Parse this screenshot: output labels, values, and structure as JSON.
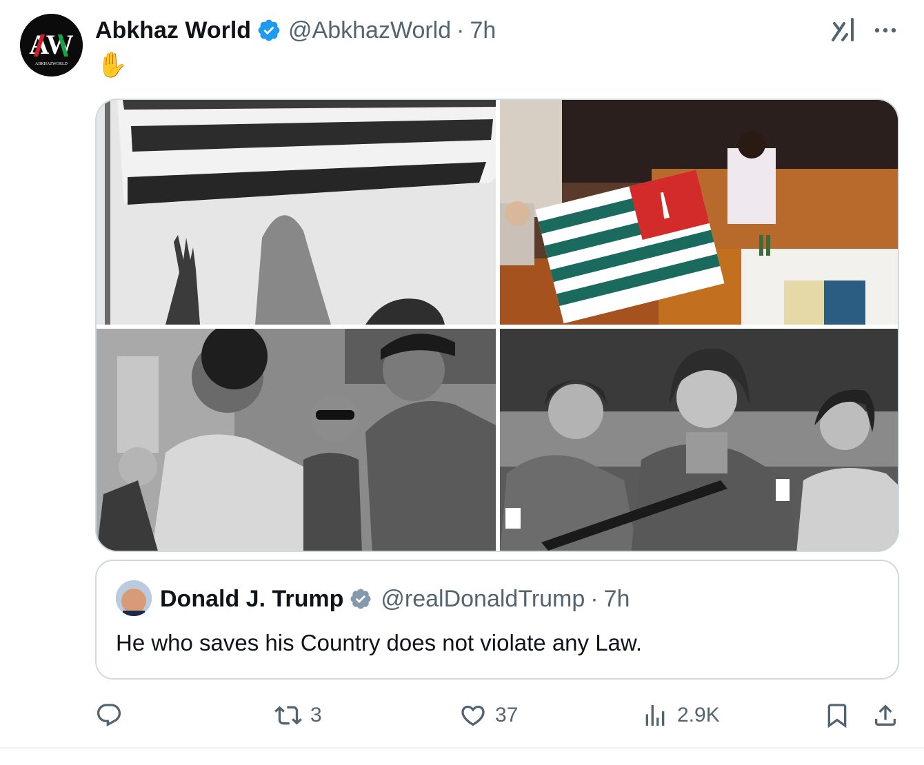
{
  "post": {
    "author_name": "Abkhaz World",
    "author_handle": "@AbkhazWorld",
    "separator": "·",
    "time": "7h",
    "avatar_text": "AW",
    "avatar_subtext": "ABKHAZWORLD",
    "text": "✋"
  },
  "media": {
    "images": [
      {
        "description": "black-and-white-flag-raising-crowd"
      },
      {
        "description": "color-abkhaz-flag-presented-on-stage"
      },
      {
        "description": "black-and-white-men-greeting"
      },
      {
        "description": "black-and-white-three-women-soldiers"
      }
    ]
  },
  "quoted": {
    "author_name": "Donald J. Trump",
    "author_handle": "@realDonaldTrump",
    "separator": "·",
    "time": "7h",
    "text": "He who saves his Country does not violate any Law."
  },
  "actions": {
    "reply_count": "",
    "repost_count": "3",
    "like_count": "37",
    "views_count": "2.9K"
  },
  "colors": {
    "text_primary": "#0f1419",
    "text_secondary": "#536471",
    "verified_blue": "#1d9bf0",
    "verified_gray": "#829aab",
    "border": "#cfd9de"
  },
  "icons": [
    "verified-badge-icon",
    "grok-icon",
    "more-icon",
    "reply-icon",
    "repost-icon",
    "like-icon",
    "views-icon",
    "bookmark-icon",
    "share-icon"
  ]
}
